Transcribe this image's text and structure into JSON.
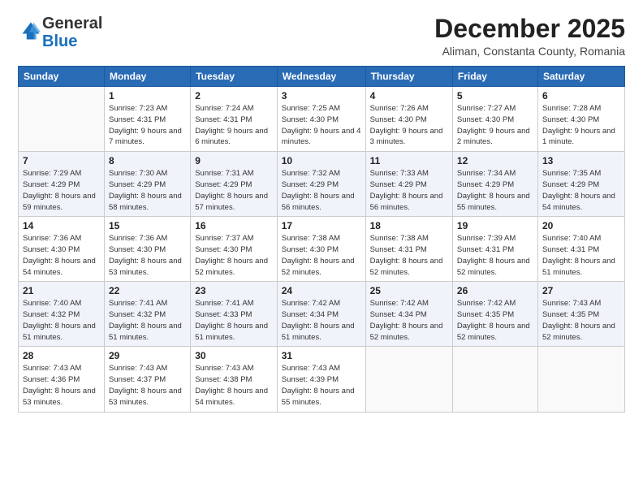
{
  "header": {
    "logo_general": "General",
    "logo_blue": "Blue",
    "month_title": "December 2025",
    "location": "Aliman, Constanta County, Romania"
  },
  "weekdays": [
    "Sunday",
    "Monday",
    "Tuesday",
    "Wednesday",
    "Thursday",
    "Friday",
    "Saturday"
  ],
  "weeks": [
    [
      {
        "day": "",
        "sunrise": "",
        "sunset": "",
        "daylight": ""
      },
      {
        "day": "1",
        "sunrise": "7:23 AM",
        "sunset": "4:31 PM",
        "daylight": "9 hours and 7 minutes."
      },
      {
        "day": "2",
        "sunrise": "7:24 AM",
        "sunset": "4:31 PM",
        "daylight": "9 hours and 6 minutes."
      },
      {
        "day": "3",
        "sunrise": "7:25 AM",
        "sunset": "4:30 PM",
        "daylight": "9 hours and 4 minutes."
      },
      {
        "day": "4",
        "sunrise": "7:26 AM",
        "sunset": "4:30 PM",
        "daylight": "9 hours and 3 minutes."
      },
      {
        "day": "5",
        "sunrise": "7:27 AM",
        "sunset": "4:30 PM",
        "daylight": "9 hours and 2 minutes."
      },
      {
        "day": "6",
        "sunrise": "7:28 AM",
        "sunset": "4:30 PM",
        "daylight": "9 hours and 1 minute."
      }
    ],
    [
      {
        "day": "7",
        "sunrise": "7:29 AM",
        "sunset": "4:29 PM",
        "daylight": "8 hours and 59 minutes."
      },
      {
        "day": "8",
        "sunrise": "7:30 AM",
        "sunset": "4:29 PM",
        "daylight": "8 hours and 58 minutes."
      },
      {
        "day": "9",
        "sunrise": "7:31 AM",
        "sunset": "4:29 PM",
        "daylight": "8 hours and 57 minutes."
      },
      {
        "day": "10",
        "sunrise": "7:32 AM",
        "sunset": "4:29 PM",
        "daylight": "8 hours and 56 minutes."
      },
      {
        "day": "11",
        "sunrise": "7:33 AM",
        "sunset": "4:29 PM",
        "daylight": "8 hours and 56 minutes."
      },
      {
        "day": "12",
        "sunrise": "7:34 AM",
        "sunset": "4:29 PM",
        "daylight": "8 hours and 55 minutes."
      },
      {
        "day": "13",
        "sunrise": "7:35 AM",
        "sunset": "4:29 PM",
        "daylight": "8 hours and 54 minutes."
      }
    ],
    [
      {
        "day": "14",
        "sunrise": "7:36 AM",
        "sunset": "4:30 PM",
        "daylight": "8 hours and 54 minutes."
      },
      {
        "day": "15",
        "sunrise": "7:36 AM",
        "sunset": "4:30 PM",
        "daylight": "8 hours and 53 minutes."
      },
      {
        "day": "16",
        "sunrise": "7:37 AM",
        "sunset": "4:30 PM",
        "daylight": "8 hours and 52 minutes."
      },
      {
        "day": "17",
        "sunrise": "7:38 AM",
        "sunset": "4:30 PM",
        "daylight": "8 hours and 52 minutes."
      },
      {
        "day": "18",
        "sunrise": "7:38 AM",
        "sunset": "4:31 PM",
        "daylight": "8 hours and 52 minutes."
      },
      {
        "day": "19",
        "sunrise": "7:39 AM",
        "sunset": "4:31 PM",
        "daylight": "8 hours and 52 minutes."
      },
      {
        "day": "20",
        "sunrise": "7:40 AM",
        "sunset": "4:31 PM",
        "daylight": "8 hours and 51 minutes."
      }
    ],
    [
      {
        "day": "21",
        "sunrise": "7:40 AM",
        "sunset": "4:32 PM",
        "daylight": "8 hours and 51 minutes."
      },
      {
        "day": "22",
        "sunrise": "7:41 AM",
        "sunset": "4:32 PM",
        "daylight": "8 hours and 51 minutes."
      },
      {
        "day": "23",
        "sunrise": "7:41 AM",
        "sunset": "4:33 PM",
        "daylight": "8 hours and 51 minutes."
      },
      {
        "day": "24",
        "sunrise": "7:42 AM",
        "sunset": "4:34 PM",
        "daylight": "8 hours and 51 minutes."
      },
      {
        "day": "25",
        "sunrise": "7:42 AM",
        "sunset": "4:34 PM",
        "daylight": "8 hours and 52 minutes."
      },
      {
        "day": "26",
        "sunrise": "7:42 AM",
        "sunset": "4:35 PM",
        "daylight": "8 hours and 52 minutes."
      },
      {
        "day": "27",
        "sunrise": "7:43 AM",
        "sunset": "4:35 PM",
        "daylight": "8 hours and 52 minutes."
      }
    ],
    [
      {
        "day": "28",
        "sunrise": "7:43 AM",
        "sunset": "4:36 PM",
        "daylight": "8 hours and 53 minutes."
      },
      {
        "day": "29",
        "sunrise": "7:43 AM",
        "sunset": "4:37 PM",
        "daylight": "8 hours and 53 minutes."
      },
      {
        "day": "30",
        "sunrise": "7:43 AM",
        "sunset": "4:38 PM",
        "daylight": "8 hours and 54 minutes."
      },
      {
        "day": "31",
        "sunrise": "7:43 AM",
        "sunset": "4:39 PM",
        "daylight": "8 hours and 55 minutes."
      },
      {
        "day": "",
        "sunrise": "",
        "sunset": "",
        "daylight": ""
      },
      {
        "day": "",
        "sunrise": "",
        "sunset": "",
        "daylight": ""
      },
      {
        "day": "",
        "sunrise": "",
        "sunset": "",
        "daylight": ""
      }
    ]
  ]
}
